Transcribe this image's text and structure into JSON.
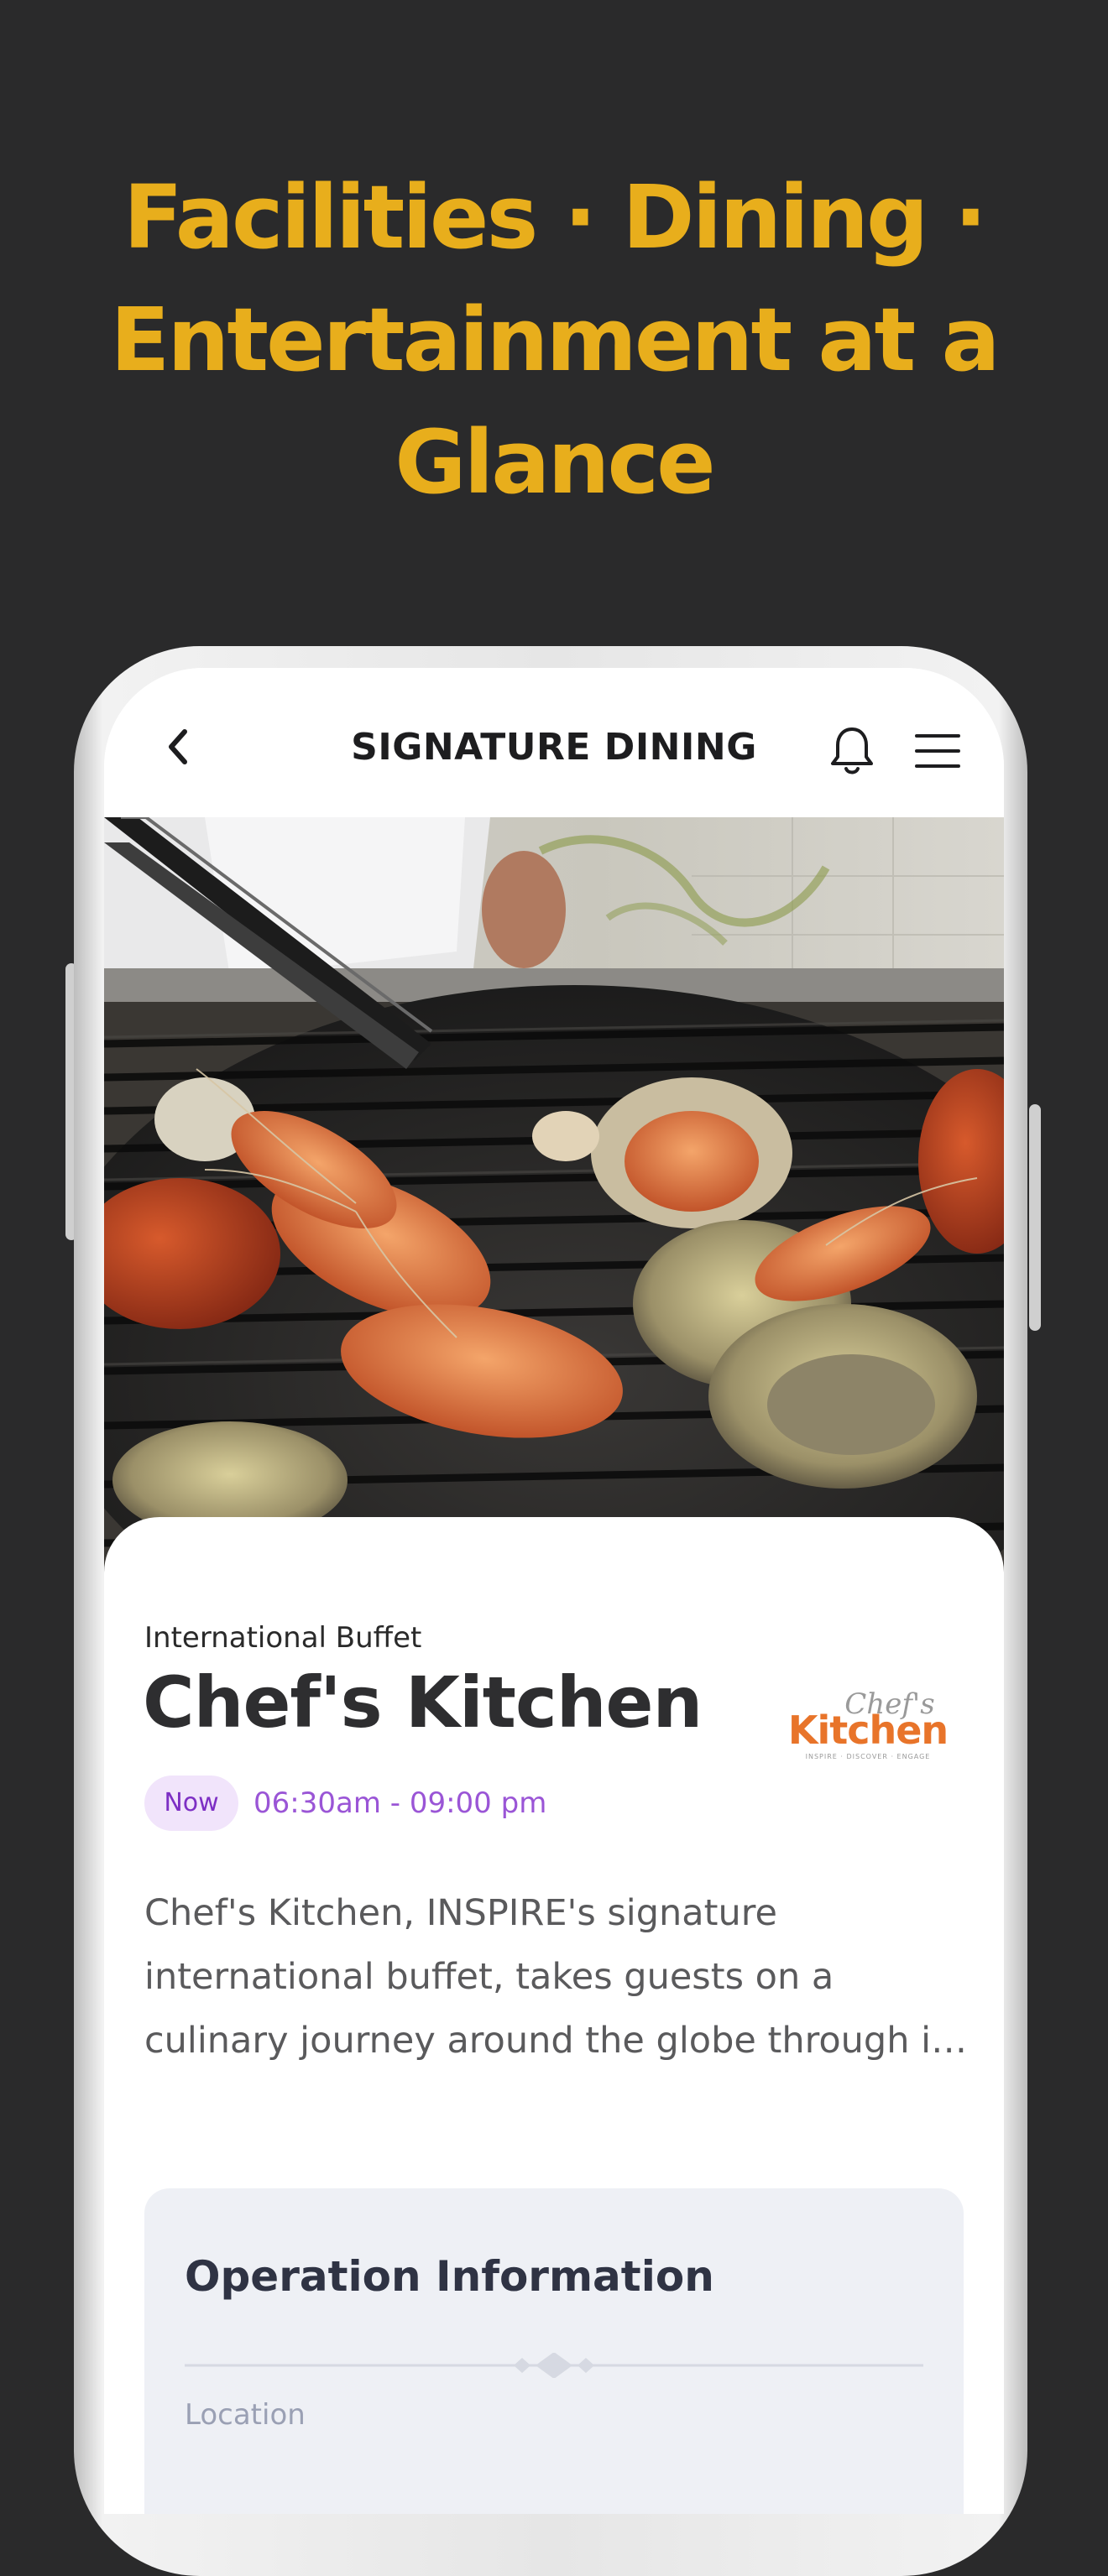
{
  "headline": {
    "line1": "Facilities · Dining ·",
    "line2": "Entertainment at a",
    "line3": "Glance"
  },
  "topbar": {
    "title": "SIGNATURE DINING",
    "back_icon": "chevron-left-icon",
    "bell_icon": "bell-icon",
    "menu_icon": "hamburger-menu-icon"
  },
  "hero": {
    "image": "grilled-seafood-photo"
  },
  "venue": {
    "category": "International Buffet",
    "name": "Chef's Kitchen",
    "logo_script": "Chef's",
    "logo_word": "Kitchen",
    "logo_tagline": "INSPIRE · DISCOVER · ENGAGE",
    "status_badge": "Now",
    "hours": "06:30am - 09:00 pm",
    "description": "Chef's Kitchen, INSPIRE's signature international buffet, takes guests on a culinary journey around the globe through its diverse array of dishes..."
  },
  "operation": {
    "title": "Operation Information",
    "location_label": "Location"
  },
  "colors": {
    "background": "#2a2a2b",
    "headline": "#e8ae1c",
    "badge_bg": "#f1e4fb",
    "badge_text": "#7d2fc4",
    "hours_text": "#9a55d6",
    "logo_orange": "#e8742a"
  }
}
